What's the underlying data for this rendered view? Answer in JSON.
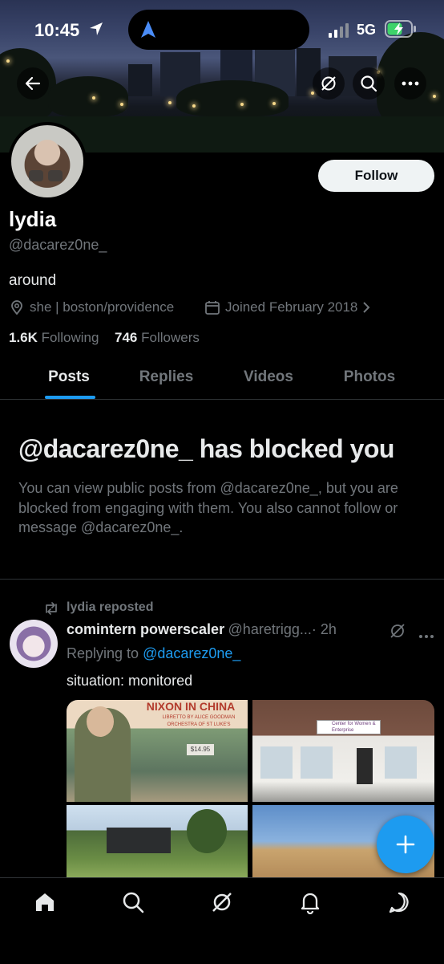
{
  "status_bar": {
    "time": "10:45",
    "network": "5G"
  },
  "header": {
    "back_icon": "arrow-left-icon",
    "grok_icon": "slash-circle-icon",
    "search_icon": "search-icon",
    "more_icon": "more-icon"
  },
  "profile": {
    "name": "lydia",
    "handle": "@dacarez0ne_",
    "follow_label": "Follow",
    "bio": "around",
    "location": "she | boston/providence",
    "joined": "Joined February 2018",
    "following_count": "1.6K",
    "following_label": "Following",
    "followers_count": "746",
    "followers_label": "Followers"
  },
  "tabs": [
    {
      "label": "Posts",
      "active": true
    },
    {
      "label": "Replies",
      "active": false
    },
    {
      "label": "Videos",
      "active": false
    },
    {
      "label": "Photos",
      "active": false
    }
  ],
  "blocked": {
    "title": "@dacarez0ne_ has blocked you",
    "body": "You can view public posts from @dacarez0ne_, but you are blocked from engaging with them. You also cannot follow or message @dacarez0ne_."
  },
  "post": {
    "repost_label": "lydia reposted",
    "author_name": "comintern powerscaler",
    "author_handle": "@haretrigg...",
    "time": "· 2h",
    "replying_prefix": "Replying to",
    "replying_to": "@dacarez0ne_",
    "text": "situation: monitored",
    "album_title": "NIXON IN CHINA",
    "album_sub": "LIBRETTO BY ALICE GOODMAN",
    "album_sub2": "ORCHESTRA OF ST LUKE'S",
    "price": "$14.95",
    "sign_text": "Center for Women & Enterprise"
  },
  "colors": {
    "accent": "#1d9bf0",
    "background": "#000000",
    "muted": "#71767b",
    "text": "#e7e9ea"
  },
  "nav": [
    "home-icon",
    "search-icon",
    "grok-icon",
    "notifications-icon",
    "messages-icon"
  ]
}
